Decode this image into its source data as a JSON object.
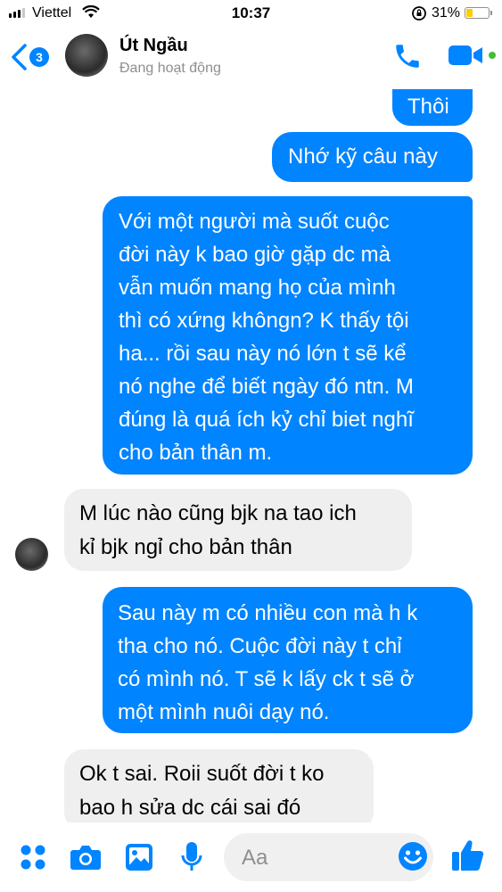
{
  "status_bar": {
    "carrier": "Viettel",
    "time": "10:37",
    "battery_percent": "31%",
    "battery_level": 0.31
  },
  "header": {
    "back_badge": "3",
    "contact_name": "Út Ngầu",
    "contact_status": "Đang hoạt động",
    "accent_color": "#0084ff"
  },
  "messages": [
    {
      "from": "me",
      "lines": [
        "Thôi"
      ]
    },
    {
      "from": "me",
      "lines": [
        "Nhớ kỹ câu này"
      ]
    },
    {
      "from": "me",
      "lines": [
        "Với một người mà suốt cuộc",
        "đời này k bao giờ gặp dc mà",
        "vẫn muốn mang họ của mình",
        "thì có xứng khôngn? K thấy tội",
        "ha... rồi sau này nó lớn t sẽ kể",
        "nó nghe để biết ngày đó ntn. M",
        "đúng là quá ích kỷ chỉ biet nghĩ",
        "cho bản thân m."
      ]
    },
    {
      "from": "them",
      "lines": [
        "M lúc nào cũng bjk na tao ich",
        "kỉ bjk ngỉ cho bản thân"
      ]
    },
    {
      "from": "me",
      "lines": [
        "Sau này m có nhiều con mà h k",
        "tha cho nó. Cuộc đời này t chỉ",
        "có mình nó. T sẽ k lấy ck t sẽ ở",
        "một mình nuôi dạy nó."
      ]
    },
    {
      "from": "them",
      "lines": [
        "Ok t sai.  Roii suốt đời t ko",
        "bao h sửa dc cái sai đó"
      ]
    }
  ],
  "composer": {
    "placeholder": "Aa",
    "icons": [
      "apps-icon",
      "camera-icon",
      "gallery-icon",
      "microphone-icon",
      "emoji-icon",
      "thumbs-up-icon"
    ]
  }
}
